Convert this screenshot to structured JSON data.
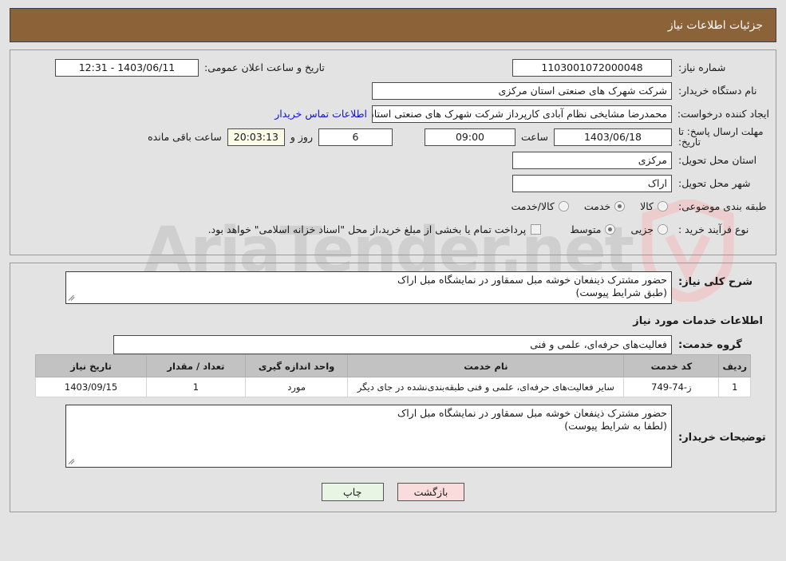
{
  "header": {
    "title": "جزئیات اطلاعات نیاز"
  },
  "info": {
    "need_number_label": "شماره نیاز:",
    "need_number_value": "1103001072000048",
    "public_announce_label": "تاریخ و ساعت اعلان عمومی:",
    "public_announce_value": "1403/06/11 - 12:31",
    "buyer_org_label": "نام دستگاه خریدار:",
    "buyer_org_value": "شرکت شهرک های صنعتی استان مرکزی",
    "creator_label": "ایجاد کننده درخواست:",
    "creator_value": "محمدرضا مشایخی نظام آبادی کارپرداز شرکت شهرک های صنعتی استان مرکزی",
    "contact_link": "اطلاعات تماس خریدار",
    "deadline_label": "مهلت ارسال پاسخ: تا تاریخ:",
    "deadline_date": "1403/06/18",
    "deadline_time_label": "ساعت",
    "deadline_time": "09:00",
    "days_value": "6",
    "days_label": "روز و",
    "remaining_time": "20:03:13",
    "remaining_label": "ساعت باقی مانده",
    "province_label": "استان محل تحویل:",
    "province_value": "مرکزی",
    "city_label": "شهر محل تحویل:",
    "city_value": "اراک",
    "category_label": "طبقه بندی موضوعی:",
    "category_options": [
      {
        "label": "کالا",
        "checked": false
      },
      {
        "label": "خدمت",
        "checked": true
      },
      {
        "label": "کالا/خدمت",
        "checked": false
      }
    ],
    "purchase_type_label": "نوع فرآیند خرید :",
    "purchase_type_options": [
      {
        "label": "جزیی",
        "checked": false
      },
      {
        "label": "متوسط",
        "checked": true
      }
    ],
    "treasury_checkbox_label": "پرداخت تمام یا بخشی از مبلغ خرید،از محل \"اسناد خزانه اسلامی\" خواهد بود.",
    "treasury_checked": false
  },
  "details": {
    "general_desc_label": "شرح کلی نیاز:",
    "general_desc_value": "حضور مشترک ذینفعان خوشه مبل سمقاور در نمایشگاه مبل اراک\n(طبق شرایط پیوست)",
    "services_section_title": "اطلاعات خدمات مورد نیاز",
    "service_group_label": "گروه خدمت:",
    "service_group_value": "فعالیت‌های حرفه‌ای، علمی و فنی",
    "buyer_notes_label": "توضیحات خریدار:",
    "buyer_notes_value": "حضور مشترک ذینفعان خوشه مبل سمقاور در نمایشگاه مبل اراک\n(لطفا به شرایط پیوست)"
  },
  "table": {
    "columns": [
      "ردیف",
      "کد خدمت",
      "نام خدمت",
      "واحد اندازه گیری",
      "تعداد / مقدار",
      "تاریخ نیاز"
    ],
    "rows": [
      {
        "radif": "1",
        "code": "ز-74-749",
        "name": "سایر فعالیت‌های حرفه‌ای، علمی و فنی طبقه‌بندی‌نشده در جای دیگر",
        "unit": "مورد",
        "qty": "1",
        "date": "1403/09/15"
      }
    ]
  },
  "buttons": {
    "print": "چاپ",
    "back": "بازگشت"
  },
  "watermark": {
    "text": "AriaTender.net"
  },
  "colors": {
    "header_bar": "#8c6239",
    "page_bg": "#e3e3e3",
    "link": "#1010d8",
    "table_header": "#c2c2c2",
    "print_btn": "#e8f5e4",
    "back_btn": "#fbdcdc",
    "countdown_bg": "#fbfbe8"
  }
}
